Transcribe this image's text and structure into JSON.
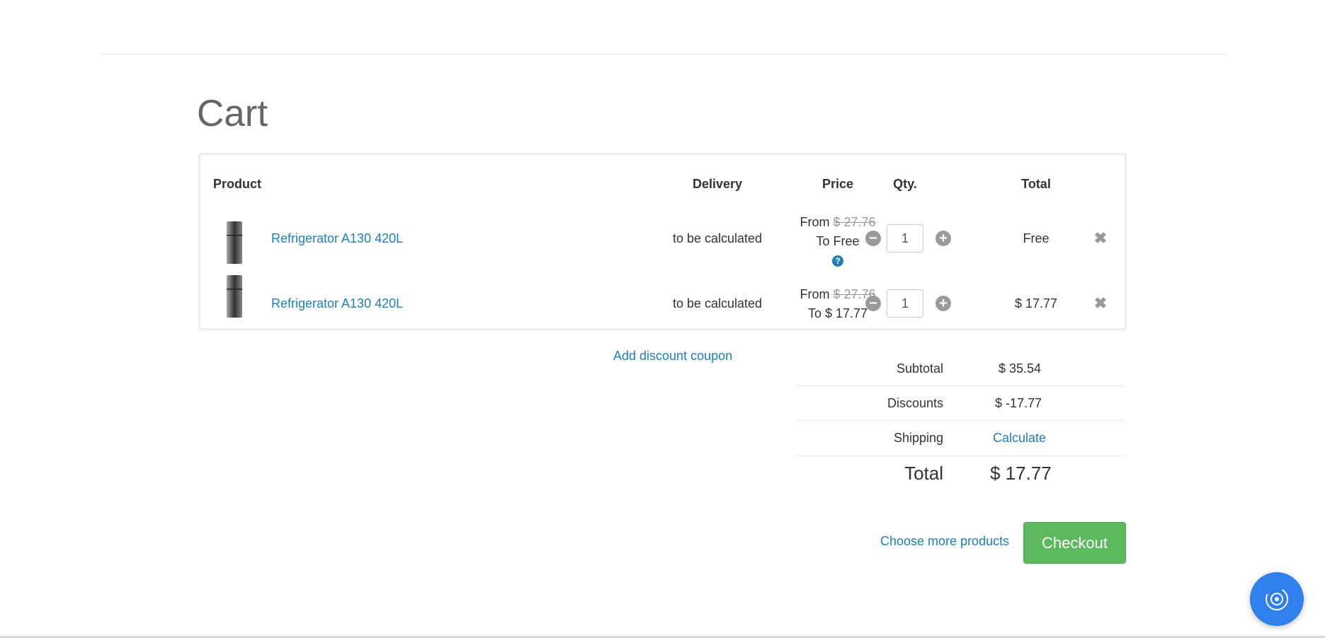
{
  "page": {
    "title": "Cart"
  },
  "table": {
    "headers": {
      "product": "Product",
      "delivery": "Delivery",
      "price": "Price",
      "qty": "Qty.",
      "total": "Total"
    },
    "rows": [
      {
        "product_name": "Refrigerator A130 420L",
        "delivery": "to be calculated",
        "price_from_label": "From",
        "price_from": "$ 27.76",
        "price_to": "To Free",
        "help_icon": "?",
        "qty": "1",
        "total": "Free"
      },
      {
        "product_name": "Refrigerator A130 420L",
        "delivery": "to be calculated",
        "price_from_label": "From",
        "price_from": "$ 27.76",
        "price_to": "To $ 17.77",
        "qty": "1",
        "total": "$ 17.77"
      }
    ]
  },
  "coupon": {
    "label": "Add discount coupon"
  },
  "summary": {
    "subtotal_label": "Subtotal",
    "subtotal_value": "$ 35.54",
    "discounts_label": "Discounts",
    "discounts_value": "$ -17.77",
    "shipping_label": "Shipping",
    "shipping_value": "Calculate",
    "total_label": "Total",
    "total_value": "$ 17.77"
  },
  "actions": {
    "more_products": "Choose more products",
    "checkout": "Checkout"
  },
  "colors": {
    "link": "#1d7fbf",
    "checkout": "#5cb85c",
    "widget": "#2f80ed"
  },
  "icons": {
    "minus": "minus-circle-icon",
    "plus": "plus-circle-icon",
    "remove": "close-icon",
    "help": "question-circle-icon",
    "widget": "chat-widget-icon"
  }
}
